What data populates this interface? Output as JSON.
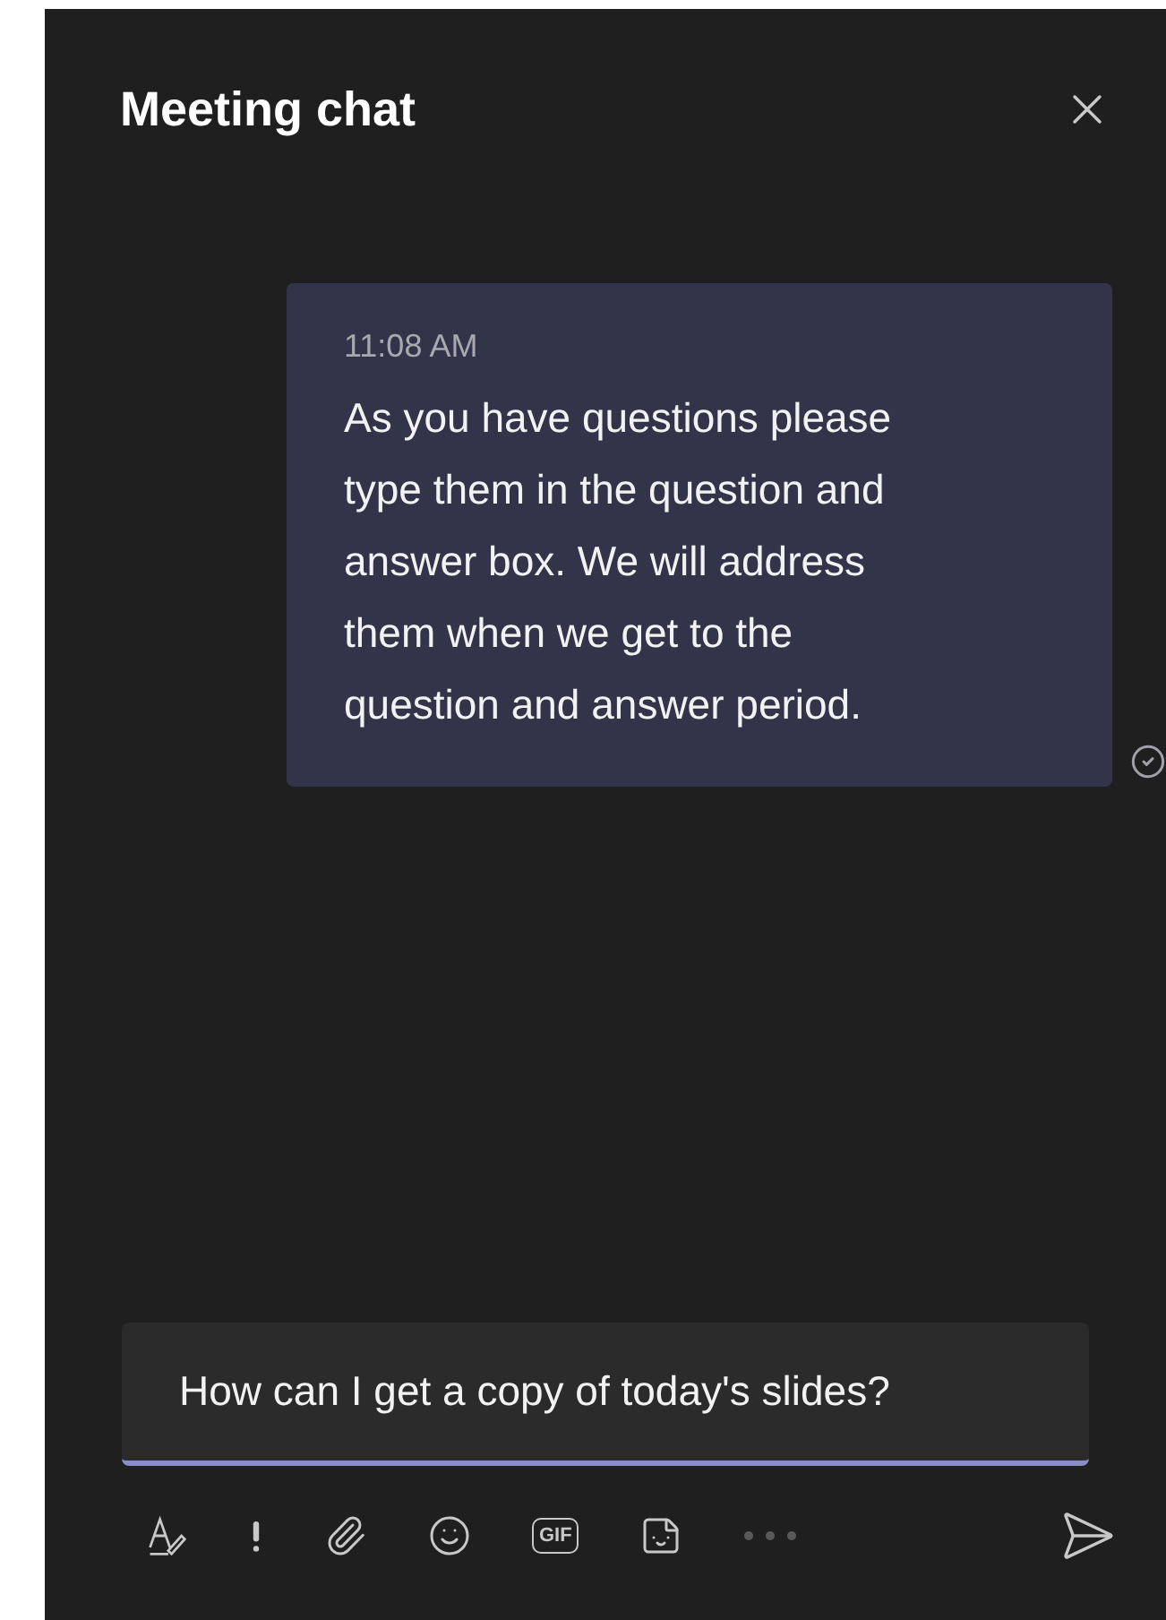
{
  "header": {
    "title": "Meeting chat"
  },
  "messages": [
    {
      "time": "11:08 AM",
      "text": "As you have questions please type them in the question and answer box. We will address them when we get to the question and answer period.",
      "seen": true
    }
  ],
  "compose": {
    "value": "How can I get a copy of today's slides?",
    "focused": true
  },
  "toolbar": [
    {
      "kind": "format"
    },
    {
      "kind": "important"
    },
    {
      "kind": "attach"
    },
    {
      "kind": "emoji"
    },
    {
      "kind": "gif",
      "label": "GIF"
    },
    {
      "kind": "sticker"
    },
    {
      "kind": "more"
    },
    {
      "kind": "send"
    }
  ]
}
